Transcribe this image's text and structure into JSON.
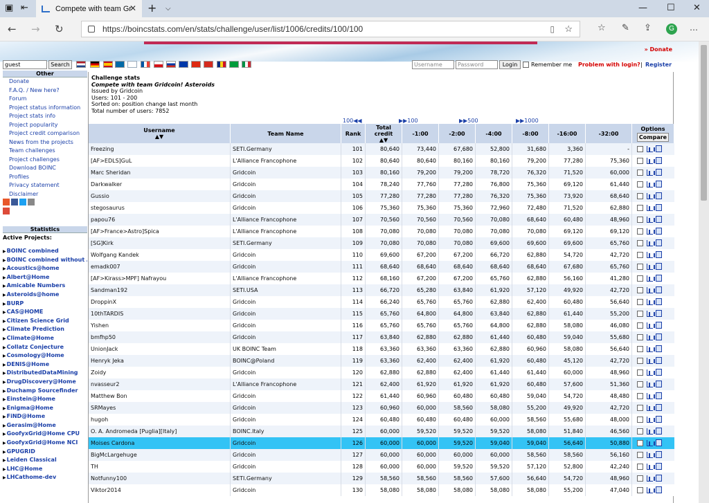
{
  "browser": {
    "tab_title": "Compete with team Gr",
    "url": "https://boincstats.com/en/stats/challenge/user/list/1006/credits/100/100",
    "window_icons": [
      "minimize-icon",
      "maximize-icon",
      "close-icon"
    ]
  },
  "header": {
    "donate": "» Donate",
    "search_value": "guest",
    "search_button": "Search",
    "username_placeholder": "Username",
    "password_placeholder": "Password",
    "login_button": "Login",
    "remember_label": "Remember me",
    "problem_link": "Problem with login?",
    "separator": "|",
    "register_link": "Register"
  },
  "sidebar": {
    "other_title": "Other",
    "links": [
      "Donate",
      "F.A.Q. / New here?",
      "Forum",
      "Project status information",
      "Project stats info",
      "Project popularity",
      "Project credit comparison",
      "News from the projects",
      "Team challenges",
      "Project challenges",
      "Download BOINC",
      "Profiles",
      "Privacy statement",
      "Disclaimer"
    ],
    "stats_title": "Statistics",
    "active_label": "Active Projects:",
    "projects": [
      "BOINC combined",
      "BOINC combined without A",
      "Acoustics@home",
      "Albert@Home",
      "Amicable Numbers",
      "Asteroids@home",
      "BURP",
      "CAS@HOME",
      "Citizen Science Grid",
      "Climate Prediction",
      "Climate@Home",
      "Collatz Conjecture",
      "Cosmology@Home",
      "DENIS@Home",
      "DistributedDataMining",
      "DrugDiscovery@Home",
      "Duchamp Sourcefinder",
      "Einstein@Home",
      "Enigma@Home",
      "FiND@Home",
      "Gerasim@Home",
      "GoofyxGrid@Home CPU",
      "GoofyxGrid@Home NCI",
      "GPUGRID",
      "Leiden Classical",
      "LHC@Home",
      "LHCathome-dev"
    ]
  },
  "info": {
    "title": "Challenge stats",
    "subtitle": "Compete with team Gridcoin! Asteroids",
    "issued": "Issued by Gridcoin",
    "users": "Users: 101 - 200",
    "sorted": "Sorted on: position change last month",
    "total": "Total number of users: 7852"
  },
  "pager": {
    "prev100": "100◀◀",
    "next100": "▶▶100",
    "next500": "▶▶500",
    "next1000": "▶▶1000"
  },
  "table": {
    "headers": {
      "username": "Username",
      "team": "Team Name",
      "rank": "Rank",
      "total1": "Total",
      "total2": "credit",
      "h1": "-1:00",
      "h2": "-2:00",
      "h4": "-4:00",
      "h8": "-8:00",
      "h16": "-16:00",
      "h32": "-32:00",
      "options": "Options",
      "compare": "Compare"
    },
    "highlight_color": "#33c3f5",
    "rows": [
      {
        "u": "Freezing",
        "t": "SETI.Germany",
        "r": "101",
        "tc": "80,640",
        "a": "73,440",
        "b": "67,680",
        "c": "52,800",
        "d": "31,680",
        "e": "3,360",
        "f": "-"
      },
      {
        "u": "[AF>EDLS]GuL",
        "t": "L'Alliance Francophone",
        "r": "102",
        "tc": "80,640",
        "a": "80,640",
        "b": "80,160",
        "c": "80,160",
        "d": "79,200",
        "e": "77,280",
        "f": "75,360"
      },
      {
        "u": "Marc Sheridan",
        "t": "Gridcoin",
        "r": "103",
        "tc": "80,160",
        "a": "79,200",
        "b": "79,200",
        "c": "78,720",
        "d": "76,320",
        "e": "71,520",
        "f": "60,000"
      },
      {
        "u": "Darkwalker",
        "t": "Gridcoin",
        "r": "104",
        "tc": "78,240",
        "a": "77,760",
        "b": "77,280",
        "c": "76,800",
        "d": "75,360",
        "e": "69,120",
        "f": "61,440"
      },
      {
        "u": "Gussio",
        "t": "Gridcoin",
        "r": "105",
        "tc": "77,280",
        "a": "77,280",
        "b": "77,280",
        "c": "76,320",
        "d": "75,360",
        "e": "73,920",
        "f": "68,640"
      },
      {
        "u": "stegosaurus",
        "t": "Gridcoin",
        "r": "106",
        "tc": "75,360",
        "a": "75,360",
        "b": "75,360",
        "c": "72,960",
        "d": "72,480",
        "e": "71,520",
        "f": "62,880"
      },
      {
        "u": "papou76",
        "t": "L'Alliance Francophone",
        "r": "107",
        "tc": "70,560",
        "a": "70,560",
        "b": "70,560",
        "c": "70,080",
        "d": "68,640",
        "e": "60,480",
        "f": "48,960"
      },
      {
        "u": "[AF>France>Astro]Spica",
        "t": "L'Alliance Francophone",
        "r": "108",
        "tc": "70,080",
        "a": "70,080",
        "b": "70,080",
        "c": "70,080",
        "d": "70,080",
        "e": "69,120",
        "f": "69,120"
      },
      {
        "u": "[SG]Kirk",
        "t": "SETI.Germany",
        "r": "109",
        "tc": "70,080",
        "a": "70,080",
        "b": "70,080",
        "c": "69,600",
        "d": "69,600",
        "e": "69,600",
        "f": "65,760"
      },
      {
        "u": "Wolfgang Kandek",
        "t": "Gridcoin",
        "r": "110",
        "tc": "69,600",
        "a": "67,200",
        "b": "67,200",
        "c": "66,720",
        "d": "62,880",
        "e": "54,720",
        "f": "42,720"
      },
      {
        "u": "emadk007",
        "t": "Gridcoin",
        "r": "111",
        "tc": "68,640",
        "a": "68,640",
        "b": "68,640",
        "c": "68,640",
        "d": "68,640",
        "e": "67,680",
        "f": "65,760"
      },
      {
        "u": "[AF>Kirass>MPF] Nafrayou",
        "t": "L'Alliance Francophone",
        "r": "112",
        "tc": "68,160",
        "a": "67,200",
        "b": "67,200",
        "c": "65,760",
        "d": "62,880",
        "e": "56,160",
        "f": "41,280"
      },
      {
        "u": "Sandman192",
        "t": "SETI.USA",
        "r": "113",
        "tc": "66,720",
        "a": "65,280",
        "b": "63,840",
        "c": "61,920",
        "d": "57,120",
        "e": "49,920",
        "f": "42,720"
      },
      {
        "u": "DroppinX",
        "t": "Gridcoin",
        "r": "114",
        "tc": "66,240",
        "a": "65,760",
        "b": "65,760",
        "c": "62,880",
        "d": "62,400",
        "e": "60,480",
        "f": "56,640"
      },
      {
        "u": "10thTARDIS",
        "t": "Gridcoin",
        "r": "115",
        "tc": "65,760",
        "a": "64,800",
        "b": "64,800",
        "c": "63,840",
        "d": "62,880",
        "e": "61,440",
        "f": "55,200"
      },
      {
        "u": "Yishen",
        "t": "Gridcoin",
        "r": "116",
        "tc": "65,760",
        "a": "65,760",
        "b": "65,760",
        "c": "64,800",
        "d": "62,880",
        "e": "58,080",
        "f": "46,080"
      },
      {
        "u": "bmfhp50",
        "t": "Gridcoin",
        "r": "117",
        "tc": "63,840",
        "a": "62,880",
        "b": "62,880",
        "c": "61,440",
        "d": "60,480",
        "e": "59,040",
        "f": "55,680"
      },
      {
        "u": "UnionJack",
        "t": "UK BOINC Team",
        "r": "118",
        "tc": "63,360",
        "a": "63,360",
        "b": "63,360",
        "c": "62,880",
        "d": "60,960",
        "e": "58,080",
        "f": "56,640"
      },
      {
        "u": "Henryk Jeka",
        "t": "BOINC@Poland",
        "r": "119",
        "tc": "63,360",
        "a": "62,400",
        "b": "62,400",
        "c": "61,920",
        "d": "60,480",
        "e": "45,120",
        "f": "42,720"
      },
      {
        "u": "Zoidy",
        "t": "Gridcoin",
        "r": "120",
        "tc": "62,880",
        "a": "62,880",
        "b": "62,400",
        "c": "61,440",
        "d": "61,440",
        "e": "60,000",
        "f": "48,960"
      },
      {
        "u": "nvasseur2",
        "t": "L'Alliance Francophone",
        "r": "121",
        "tc": "62,400",
        "a": "61,920",
        "b": "61,920",
        "c": "61,920",
        "d": "60,480",
        "e": "57,600",
        "f": "51,360"
      },
      {
        "u": "Matthew Bon",
        "t": "Gridcoin",
        "r": "122",
        "tc": "61,440",
        "a": "60,960",
        "b": "60,480",
        "c": "60,480",
        "d": "59,040",
        "e": "54,720",
        "f": "48,480"
      },
      {
        "u": "SRMayes",
        "t": "Gridcoin",
        "r": "123",
        "tc": "60,960",
        "a": "60,000",
        "b": "58,560",
        "c": "58,080",
        "d": "55,200",
        "e": "49,920",
        "f": "42,720"
      },
      {
        "u": "hugoh",
        "t": "Gridcoin",
        "r": "124",
        "tc": "60,480",
        "a": "60,480",
        "b": "60,480",
        "c": "60,000",
        "d": "58,560",
        "e": "55,680",
        "f": "48,000"
      },
      {
        "u": "O. A. Andromeda [Puglia][Italy]",
        "t": "BOINC.Italy",
        "r": "125",
        "tc": "60,000",
        "a": "59,520",
        "b": "59,520",
        "c": "59,520",
        "d": "58,080",
        "e": "51,840",
        "f": "46,560"
      },
      {
        "u": "Moises Cardona",
        "t": "Gridcoin",
        "r": "126",
        "tc": "60,000",
        "a": "60,000",
        "b": "59,520",
        "c": "59,040",
        "d": "59,040",
        "e": "56,640",
        "f": "50,880",
        "hl": true
      },
      {
        "u": "BigMcLargehuge",
        "t": "Gridcoin",
        "r": "127",
        "tc": "60,000",
        "a": "60,000",
        "b": "60,000",
        "c": "60,000",
        "d": "58,560",
        "e": "58,560",
        "f": "56,160"
      },
      {
        "u": "TH",
        "t": "Gridcoin",
        "r": "128",
        "tc": "60,000",
        "a": "60,000",
        "b": "59,520",
        "c": "59,520",
        "d": "57,120",
        "e": "52,800",
        "f": "42,240"
      },
      {
        "u": "Notfunny100",
        "t": "SETI.Germany",
        "r": "129",
        "tc": "58,560",
        "a": "58,560",
        "b": "58,560",
        "c": "57,600",
        "d": "56,640",
        "e": "54,720",
        "f": "48,960"
      },
      {
        "u": "Viktor2014",
        "t": "Gridcoin",
        "r": "130",
        "tc": "58,080",
        "a": "58,080",
        "b": "58,080",
        "c": "58,080",
        "d": "58,080",
        "e": "55,200",
        "f": "47,040"
      }
    ]
  }
}
